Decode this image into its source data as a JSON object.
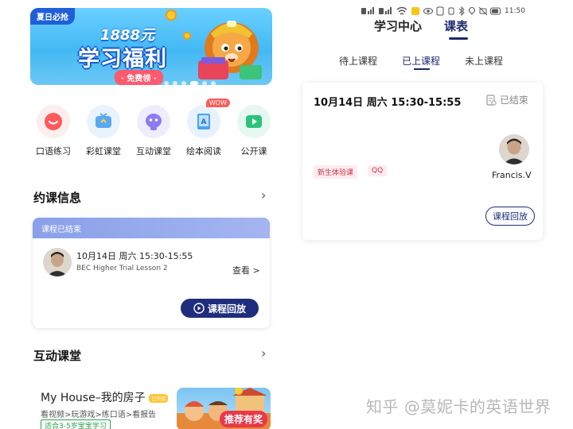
{
  "left": {
    "banner": {
      "tag": "夏日必抢",
      "amount": "1888元",
      "title": "学习福利",
      "subtitle": "· 免费领 ·"
    },
    "quick_actions": [
      {
        "label": "口语练习",
        "icon": "speech-bubble-icon",
        "color": "#ff5a5a",
        "bg": "#fdeeee"
      },
      {
        "label": "彩虹课堂",
        "icon": "tv-icon",
        "color": "#5aa8f0",
        "bg": "#e9f3fd"
      },
      {
        "label": "互动课堂",
        "icon": "robot-icon",
        "color": "#8b7cf2",
        "bg": "#efedfd"
      },
      {
        "label": "绘本阅读",
        "icon": "book-icon",
        "color": "#4aa3f0",
        "bg": "#e8f2fc",
        "badge": "WOW"
      },
      {
        "label": "公开课",
        "icon": "play-icon",
        "color": "#2bc27a",
        "bg": "#e6f8ef"
      }
    ],
    "booking": {
      "title": "约课信息",
      "status": "课程已结束",
      "time": "10月14日 周六 15:30-15:55",
      "lesson": "BEC Higher Trial Lesson 2",
      "view": "查看 >",
      "replay": "课程回放"
    },
    "interactive": {
      "title": "互动课堂",
      "card_title": "My House–我的房子",
      "card_badge": "已完成",
      "card_desc": "看视频>玩游戏>练口语>看报告",
      "card_age": "适合3-5岁宝宝学习",
      "thumb_label": "推荐有奖"
    }
  },
  "right": {
    "statusbar": {
      "time": "11:50"
    },
    "tabs": [
      "学习中心",
      "课表"
    ],
    "subtabs": [
      "待上课程",
      "已上课程",
      "未上课程"
    ],
    "card": {
      "time": "10月14日 周六 15:30-15:55",
      "status": "已结束",
      "tags": [
        "新生体验课",
        "QQ"
      ],
      "teacher": "Francis.V",
      "replay": "课程回放"
    }
  },
  "watermark": "知乎 @莫妮卡的英语世界",
  "colors": {
    "accent": "#1e2d7c",
    "card_head": "#8aa0e8",
    "tag_red": "#c9364a"
  }
}
